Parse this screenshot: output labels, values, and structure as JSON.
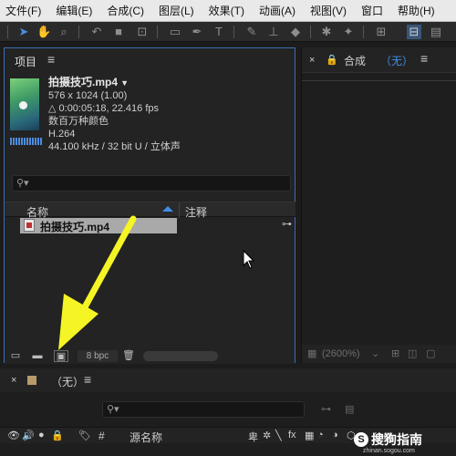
{
  "menubar": {
    "items": [
      "文件(F)",
      "编辑(E)",
      "合成(C)",
      "图层(L)",
      "效果(T)",
      "动画(A)",
      "视图(V)",
      "窗口",
      "帮助(H)"
    ]
  },
  "toolbar": {
    "icons": [
      "selection-tool-icon",
      "hand-tool-icon",
      "zoom-tool-icon",
      "rotate-tool-icon",
      "camera-tool-icon",
      "pan-behind-tool-icon",
      "shape-tool-icon",
      "pen-tool-icon",
      "type-tool-icon",
      "brush-tool-icon",
      "clone-stamp-tool-icon",
      "eraser-tool-icon",
      "roto-brush-tool-icon",
      "puppet-tool-icon"
    ]
  },
  "project_panel": {
    "tab_label": "项目",
    "menu_glyph": "≡",
    "asset": {
      "name": "拍摄技巧.mp4",
      "dropdown": "▼",
      "resolution": "576 x 1024 (1.00)",
      "duration": "△ 0:00:05:18, 22.416 fps",
      "color": "数百万种颜色",
      "codec": "H.264",
      "audio": "44.100 kHz / 32 bit U / 立体声"
    },
    "search": {
      "placeholder": ""
    },
    "columns": {
      "name": "名称",
      "comment": "注释"
    },
    "files": [
      {
        "name": "拍摄技巧.mp4",
        "selected": true
      }
    ],
    "bottom": {
      "bpc_label": "8 bpc"
    }
  },
  "composition_panel": {
    "close": "×",
    "tab_label": "合成",
    "tab_value": "（无）",
    "menu_glyph": "≡",
    "zoom": "(2600%)"
  },
  "timeline": {
    "close": "×",
    "tab_label": "（无）",
    "menu_glyph": "≡",
    "columns": {
      "hash": "#",
      "source_name": "源名称",
      "parent": "父级"
    }
  },
  "watermark": {
    "badge": "S",
    "text": "搜狗指南",
    "url": "zhinan.sogou.com"
  },
  "colors": {
    "accent_blue": "#3f8de6",
    "annotation_arrow": "#f5f525",
    "selection_row": "#a9a9a9"
  }
}
